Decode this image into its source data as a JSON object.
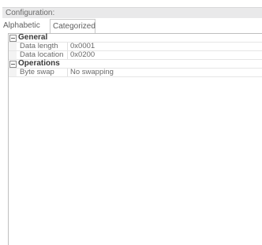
{
  "panel": {
    "title": "Configuration:"
  },
  "tabs": [
    {
      "label": "Alphabetic",
      "selected": false
    },
    {
      "label": "Categorized",
      "selected": true
    }
  ],
  "grid": {
    "categories": [
      {
        "name": "General",
        "expanded": true,
        "icon": "collapse-minus-icon",
        "properties": [
          {
            "name": "Data length",
            "value": "0x0001"
          },
          {
            "name": "Data location",
            "value": "0x0200"
          }
        ]
      },
      {
        "name": "Operations",
        "expanded": true,
        "icon": "collapse-minus-icon",
        "properties": [
          {
            "name": "Byte swap",
            "value": "No swapping"
          }
        ]
      }
    ]
  }
}
